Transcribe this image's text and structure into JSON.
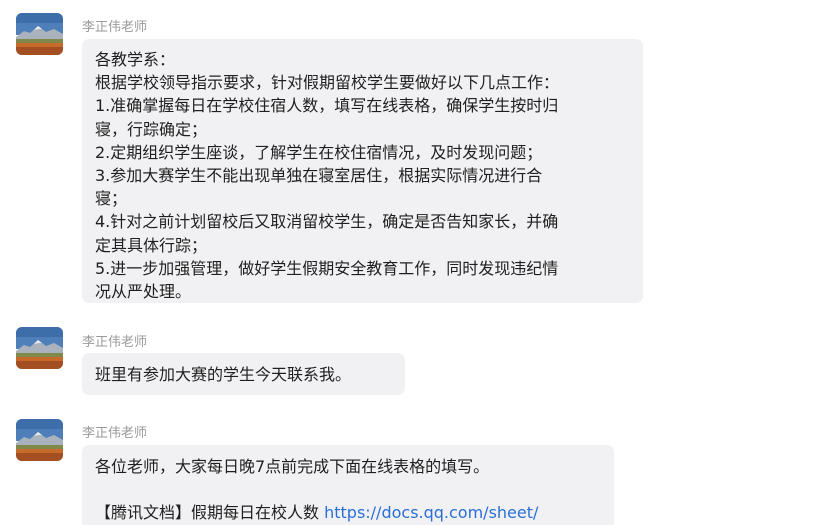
{
  "messages": [
    {
      "sender": "李正伟老师",
      "lines": [
        "各教学系：",
        "根据学校领导指示要求，针对假期留校学生要做好以下几点工作：",
        "1.准确掌握每日在学校住宿人数，填写在线表格，确保学生按时归",
        "寝，行踪确定；",
        "2.定期组织学生座谈，了解学生在校住宿情况，及时发现问题；",
        "3.参加大赛学生不能出现单独在寝室居住，根据实际情况进行合",
        "寝；",
        "4.针对之前计划留校后又取消留校学生，确定是否告知家长，并确",
        "定其具体行踪；",
        "5.进一步加强管理，做好学生假期安全教育工作，同时发现违纪情",
        "况从严处理。"
      ]
    },
    {
      "sender": "李正伟老师",
      "lines": [
        "班里有参加大赛的学生今天联系我。"
      ]
    },
    {
      "sender": "李正伟老师",
      "line1": "各位老师，大家每日晚7点前完成下面在线表格的填写。",
      "line3_prefix": "【腾讯文档】假期每日在校人数 ",
      "line3_link": "https://docs.qq.com/sheet/"
    }
  ]
}
